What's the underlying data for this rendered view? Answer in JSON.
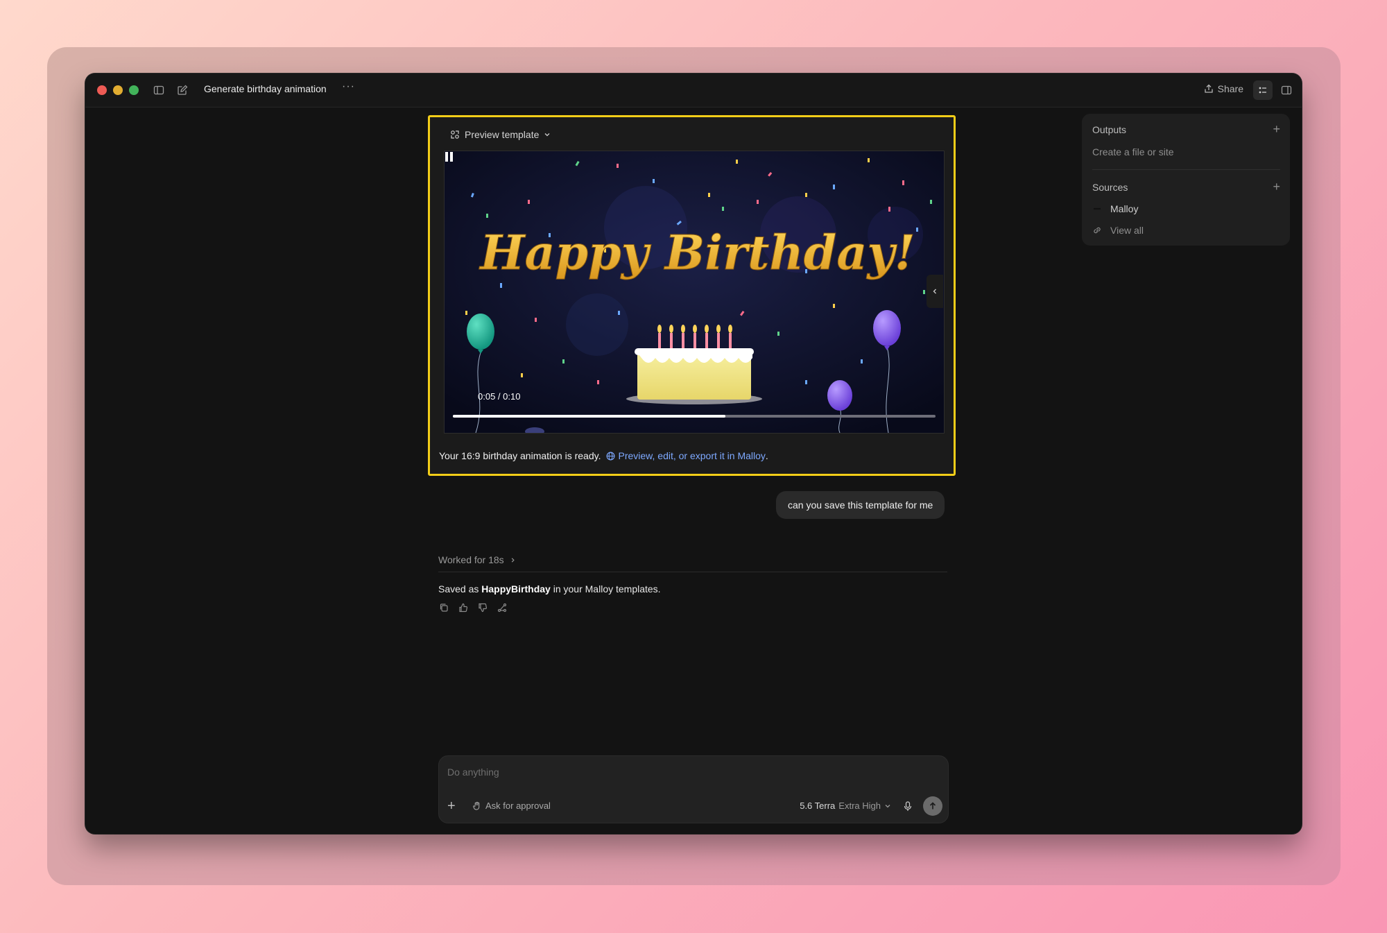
{
  "window": {
    "title": "Generate birthday animation",
    "more": "···",
    "share_label": "Share"
  },
  "preview": {
    "header": "Preview template",
    "video_heading": "Happy Birthday!",
    "time": "0:05 / 0:10",
    "progress": 0.565,
    "ready_text": "Your 16:9 birthday animation is ready.",
    "link_text": "Preview, edit, or export it in Malloy",
    "link_suffix": "."
  },
  "sidebar": {
    "outputs_title": "Outputs",
    "outputs_sub": "Create a file or site",
    "sources_title": "Sources",
    "source_item": "Malloy",
    "view_all": "View all"
  },
  "chat": {
    "user_message": "can you save this template for me",
    "worked": "Worked for 18s",
    "saved_prefix": "Saved as ",
    "saved_name": "HappyBirthday",
    "saved_suffix": " in your Malloy templates."
  },
  "composer": {
    "placeholder": "Do anything",
    "approval": "Ask for approval",
    "model": "5.6 Terra",
    "effort": "Extra High"
  },
  "colors": {
    "accent_yellow": "#f2cd18",
    "link_blue": "#7ea9ff",
    "cake_gold": "#e8b52c"
  }
}
